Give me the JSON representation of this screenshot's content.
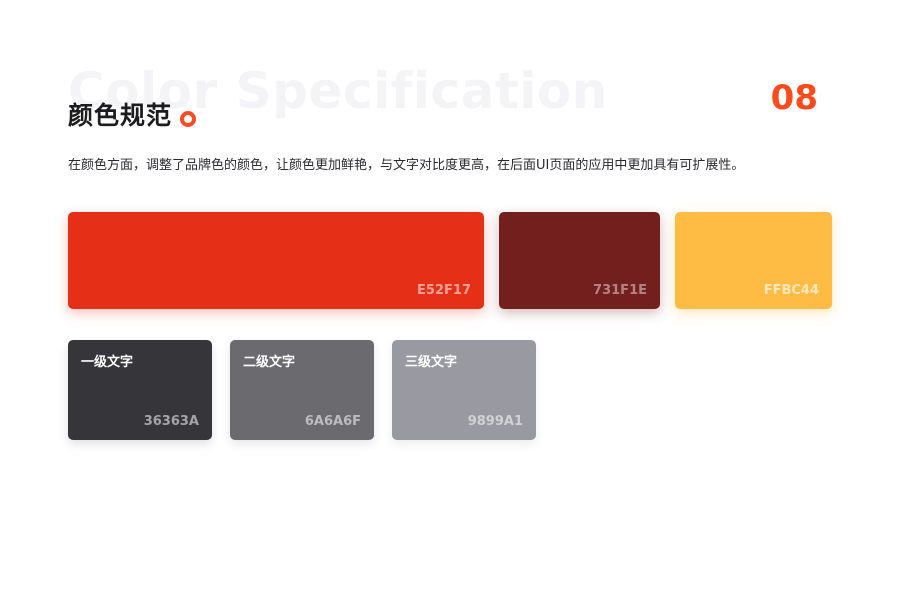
{
  "header": {
    "bg_title": "Color Specification",
    "title": "颜色规范",
    "page_number": "08",
    "description": "在颜色方面，调整了品牌色的颜色，让颜色更加鲜艳，与文字对比度更高，在后面UI页面的应用中更加具有可扩展性。"
  },
  "brand_colors": [
    {
      "hex": "E52F17",
      "color": "#e52f17"
    },
    {
      "hex": "731F1E",
      "color": "#731f1e"
    },
    {
      "hex": "FFBC44",
      "color": "#ffbc44"
    }
  ],
  "text_colors": [
    {
      "label": "一级文字",
      "hex": "36363A",
      "color": "#36363a"
    },
    {
      "label": "二级文字",
      "hex": "6A6A6F",
      "color": "#6a6a6f"
    },
    {
      "label": "三级文字",
      "hex": "9899A1",
      "color": "#9899a1"
    }
  ],
  "accent_color": "#ff4a1c"
}
